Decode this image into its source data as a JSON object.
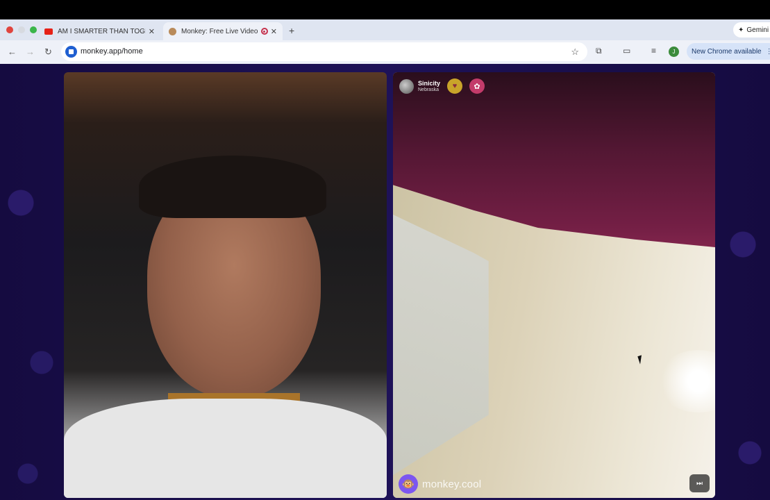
{
  "browser": {
    "tabs": [
      {
        "title": "AM I SMARTER THAN TOGI?",
        "active": false,
        "favicon": "youtube-icon"
      },
      {
        "title": "Monkey: Free Live Video Chat",
        "active": true,
        "favicon": "monkey-icon"
      }
    ],
    "gemini_label": "Gemini",
    "url": "monkey.app/home",
    "profile_initial": "J",
    "update_label": "New Chrome available"
  },
  "video_chat": {
    "partner": {
      "name": "Sinicity",
      "location": "Nebraska"
    },
    "brand_label": "monkey.cool",
    "colors": {
      "page_bg": "#180e48",
      "brand_accent": "#7c56f0"
    }
  }
}
